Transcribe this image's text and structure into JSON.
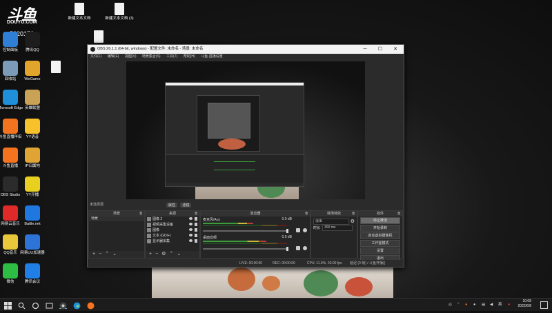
{
  "desktop": {
    "logo": {
      "main": "斗鱼",
      "sub": "DOUYU.COM",
      "num": "5220176"
    },
    "icons": [
      {
        "label": "控制面板",
        "color": "#2f7fd6"
      },
      {
        "label": "腾讯QQ",
        "color": "#1d1d1d"
      },
      {
        "label": "回收站",
        "color": "#7c9bb8"
      },
      {
        "label": "WeGame",
        "color": "#e2a52b"
      },
      {
        "label": "Microsoft Edge",
        "color": "#1e8fd8"
      },
      {
        "label": "英雄联盟",
        "color": "#caa255"
      },
      {
        "label": "斗鱼直播伴侣",
        "color": "#f3731f"
      },
      {
        "label": "YY语音",
        "color": "#f6c12a"
      },
      {
        "label": "斗鱼直播",
        "color": "#f3731f"
      },
      {
        "label": "IP归属地",
        "color": "#e0a434"
      },
      {
        "label": "OBS Studio",
        "color": "#2b2b2b"
      },
      {
        "label": "YY开播",
        "color": "#e8d020"
      },
      {
        "label": "网易云音乐",
        "color": "#e02a2a"
      },
      {
        "label": "Battle.net",
        "color": "#1e78e0"
      },
      {
        "label": "QQ音乐",
        "color": "#e8c83a"
      },
      {
        "label": "网易UU加速器",
        "color": "#2d73d8"
      },
      {
        "label": "微信",
        "color": "#2dbd45"
      },
      {
        "label": "腾讯会议",
        "color": "#1f7fe6"
      }
    ],
    "files": [
      {
        "label": "新建文本文档"
      },
      {
        "label": "新建文本文档 (3)"
      }
    ]
  },
  "obs": {
    "title": "OBS 26.1.1 (64-bit, windows) - 配置文件: 未命名 - 场景: 未命名",
    "menu": [
      "文件(F)",
      "编辑(E)",
      "视图(V)",
      "场景集合(S)",
      "工具(T)",
      "帮助(H)",
      "斗鱼-直播设置"
    ],
    "status_left": "未选择源",
    "props_btn": "属性",
    "filter_btn": "滤镜",
    "docks": {
      "scenes": {
        "title": "场景",
        "items": [
          "场景"
        ]
      },
      "sources": {
        "title": "来源",
        "items": [
          "图像 2",
          "视频采集设备",
          "图像",
          "文本 (GDI+)",
          "显示器采集"
        ]
      },
      "mixer": {
        "title": "混音器",
        "tracks": [
          {
            "name": "麦克风/Aux",
            "db": "0.0 dB",
            "level": 0.6
          },
          {
            "name": "桌面音频",
            "db": "0.0 dB",
            "level": 0.75
          }
        ]
      },
      "transitions": {
        "title": "转场特效",
        "type": "淡出",
        "duration_label": "时长",
        "duration": "300 ms"
      },
      "controls": {
        "title": "控件",
        "buttons": [
          "停止推流",
          "开始录制",
          "启动虚拟摄像机",
          "工作室模式",
          "设置",
          "退出"
        ]
      }
    },
    "statusbar": {
      "live": "LIVE: 00:00:00",
      "rec": "REC: 00:00:00",
      "cpu": "CPU: 11.9%, 30.00 fps",
      "right": "延迟 (0 帧) / 斗鱼开播()"
    }
  },
  "taskbar": {
    "time": "10:08",
    "date": "2022/6/8",
    "lang": "英"
  }
}
